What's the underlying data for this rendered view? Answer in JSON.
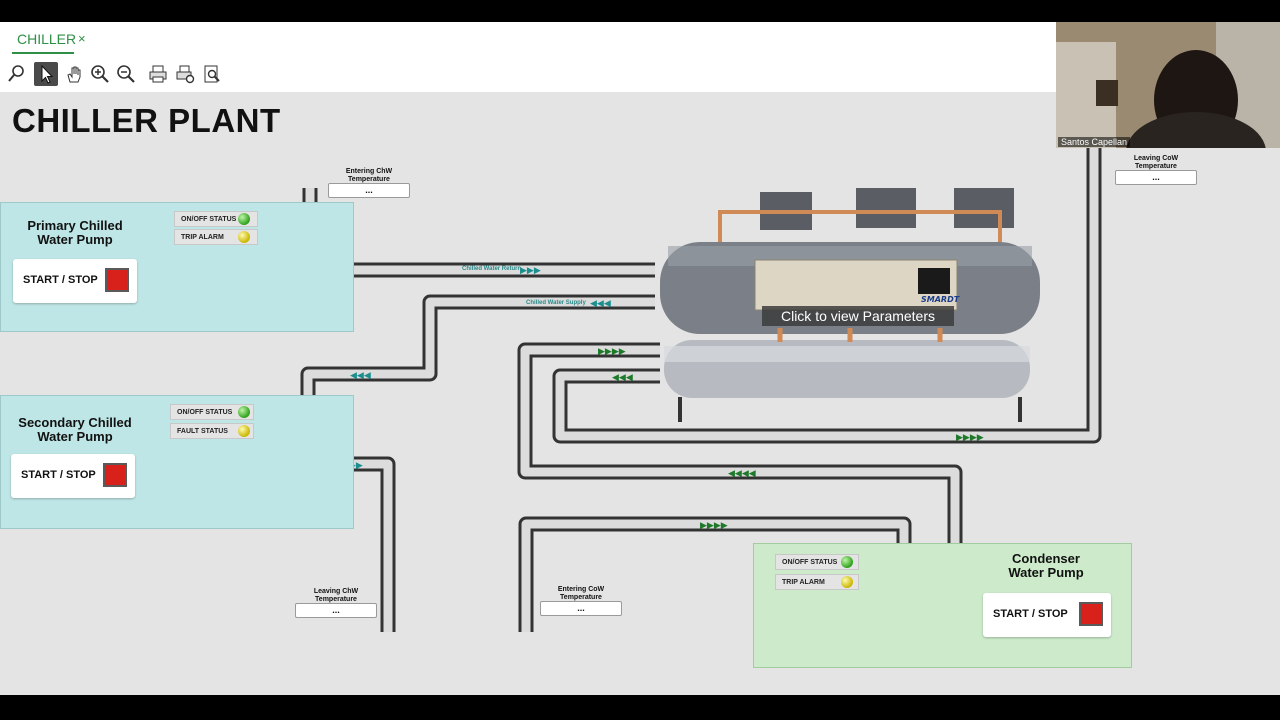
{
  "tab": {
    "label": "CHILLER",
    "close": "×"
  },
  "toolbar": {
    "tools": [
      "pan-search-icon",
      "pointer-icon",
      "hand-icon",
      "zoom-in-icon",
      "zoom-out-icon",
      "print-icon",
      "print-settings-icon",
      "print-preview-icon"
    ]
  },
  "page": {
    "title": "CHILLER PLANT"
  },
  "primary_pump": {
    "title": "Primary Chilled Water Pump",
    "start_stop": "START / STOP",
    "status1": "ON/OFF STATUS",
    "status2": "TRIP ALARM"
  },
  "secondary_pump": {
    "title": "Secondary Chilled Water Pump",
    "start_stop": "START / STOP",
    "status1": "ON/OFF STATUS",
    "status2": "FAULT STATUS"
  },
  "condenser_pump": {
    "title": "Condenser Water Pump",
    "start_stop": "START / STOP",
    "status1": "ON/OFF STATUS",
    "status2": "TRIP ALARM"
  },
  "temps": {
    "entering_chw": {
      "label": "Entering ChW Temperature",
      "value": "..."
    },
    "leaving_chw": {
      "label": "Leaving ChW Temperature",
      "value": "..."
    },
    "entering_cow": {
      "label": "Entering CoW Temperature",
      "value": "..."
    },
    "leaving_cow": {
      "label": "Leaving CoW Temperature",
      "value": "..."
    }
  },
  "pipes": {
    "return_label": "Chilled Water Return",
    "supply_label": "Chilled Water Supply"
  },
  "chiller": {
    "cta": "Click to view Parameters",
    "brand": "SMARDT"
  },
  "webcam": {
    "name": "Santos Capellan"
  },
  "colors": {
    "accent": "#2f8f46",
    "panel_blue": "#bfe6e6",
    "panel_green": "#cdebcb",
    "stop_red": "#d9211b"
  }
}
